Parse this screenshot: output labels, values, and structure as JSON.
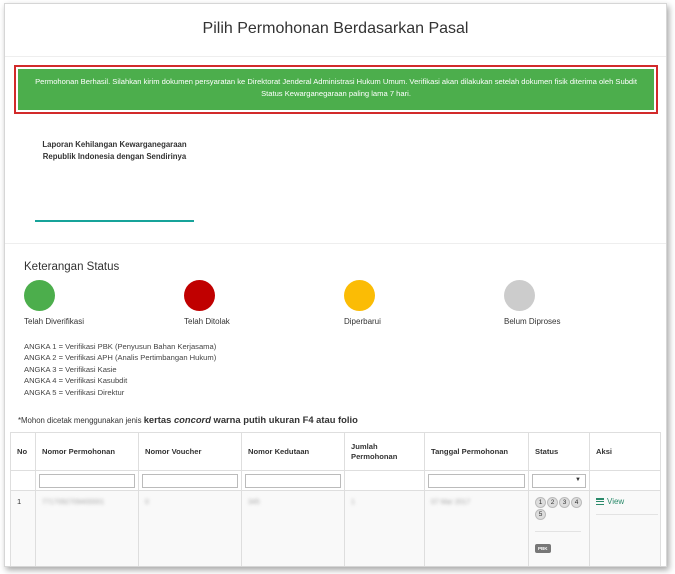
{
  "page": {
    "title": "Pilih Permohonan Berdasarkan Pasal"
  },
  "alert": {
    "message": "Permohonan Berhasil. Silahkan kirim dokumen persyaratan ke Direktorat Jenderal Administrasi Hukum Umum. Verifikasi akan dilakukan setelah dokumen fisik diterima oleh Subdit Status Kewarganegaraan paling lama 7 hari.",
    "color": "#4cae4c",
    "outline_color": "#d22a2a"
  },
  "tab": {
    "label": "Laporan Kehilangan Kewarganegaraan Republik Indonesia dengan Sendirinya",
    "underline_color": "#17a39a"
  },
  "status_legend": {
    "heading": "Keterangan Status",
    "items": [
      {
        "label": "Telah Diverifikasi",
        "color": "#4cae4c"
      },
      {
        "label": "Telah Ditolak",
        "color": "#c00000"
      },
      {
        "label": "Diperbarui",
        "color": "#fbbc05"
      },
      {
        "label": "Belum Diproses",
        "color": "#cccccc"
      }
    ]
  },
  "angka": [
    "ANGKA 1 = Verifikasi PBK (Penyusun Bahan Kerjasama)",
    "ANGKA 2 = Verifikasi APH (Analis Pertimbangan Hukum)",
    "ANGKA 3 = Verifikasi Kasie",
    "ANGKA 4 = Verifikasi Kasubdit",
    "ANGKA 5 = Verifikasi Direktur"
  ],
  "print_note": {
    "prefix": "*Mohon dicetak menggunakan jenis ",
    "emphasis_1": "kertas ",
    "emphasis_italic": "concord",
    "emphasis_2": " warna putih ukuran F4 atau folio"
  },
  "table": {
    "headers": {
      "no": "No",
      "nomor_permohonan": "Nomor Permohonan",
      "nomor_voucher": "Nomor Voucher",
      "nomor_kedutaan": "Nomor Kedutaan",
      "jumlah_permohonan": "Jumlah Permohonan",
      "tanggal_permohonan": "Tanggal Permohonan",
      "status": "Status",
      "aksi": "Aksi"
    },
    "rows": [
      {
        "no": "1",
        "nomor_permohonan": "7717092709400001",
        "nomor_voucher": "0",
        "nomor_kedutaan": "345",
        "jumlah_permohonan": "1",
        "tanggal_permohonan": "07 Mar 2017",
        "steps": [
          "1",
          "2",
          "3",
          "4",
          "5"
        ],
        "badge": "PBK",
        "action": "View"
      }
    ]
  }
}
